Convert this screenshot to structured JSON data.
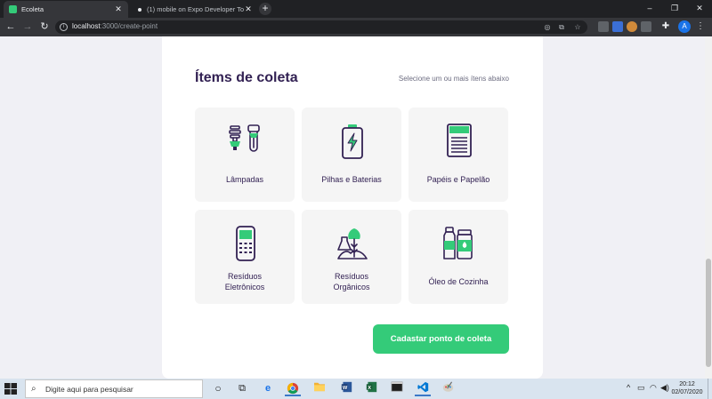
{
  "browser": {
    "tabs": [
      {
        "title": "Ecoleta",
        "active": true
      },
      {
        "title": "(1) mobile on Expo Developer To",
        "active": false
      }
    ],
    "new_tab_symbol": "+",
    "url_host": "localhost",
    "url_path": ":3000/create-point",
    "window_controls": {
      "minimize": "–",
      "maximize": "❐",
      "close": "✕"
    },
    "profile_initial": "A"
  },
  "form": {
    "legend": "Ítems de coleta",
    "hint": "Selecione um ou mais ítens abaixo",
    "items": [
      {
        "line1": "Lâmpadas",
        "line2": "",
        "icon": "lamps-icon"
      },
      {
        "line1": "Pilhas e Baterias",
        "line2": "",
        "icon": "battery-icon"
      },
      {
        "line1": "Papéis e Papelão",
        "line2": "",
        "icon": "paper-icon"
      },
      {
        "line1": "Resíduos",
        "line2": "Eletrônicos",
        "icon": "electronics-icon"
      },
      {
        "line1": "Resíduos",
        "line2": "Orgânicos",
        "icon": "organic-icon"
      },
      {
        "line1": "Óleo de Cozinha",
        "line2": "",
        "icon": "oil-icon"
      }
    ],
    "submit_label": "Cadastar ponto de coleta"
  },
  "colors": {
    "primary": "#34cb79",
    "title": "#322153",
    "text": "#6c6c80",
    "item_bg": "#f5f5f5",
    "page_bg": "#f0f0f5"
  },
  "taskbar": {
    "search_placeholder": "Digite aqui para pesquisar",
    "time": "20:12",
    "date": "02/07/2020"
  }
}
